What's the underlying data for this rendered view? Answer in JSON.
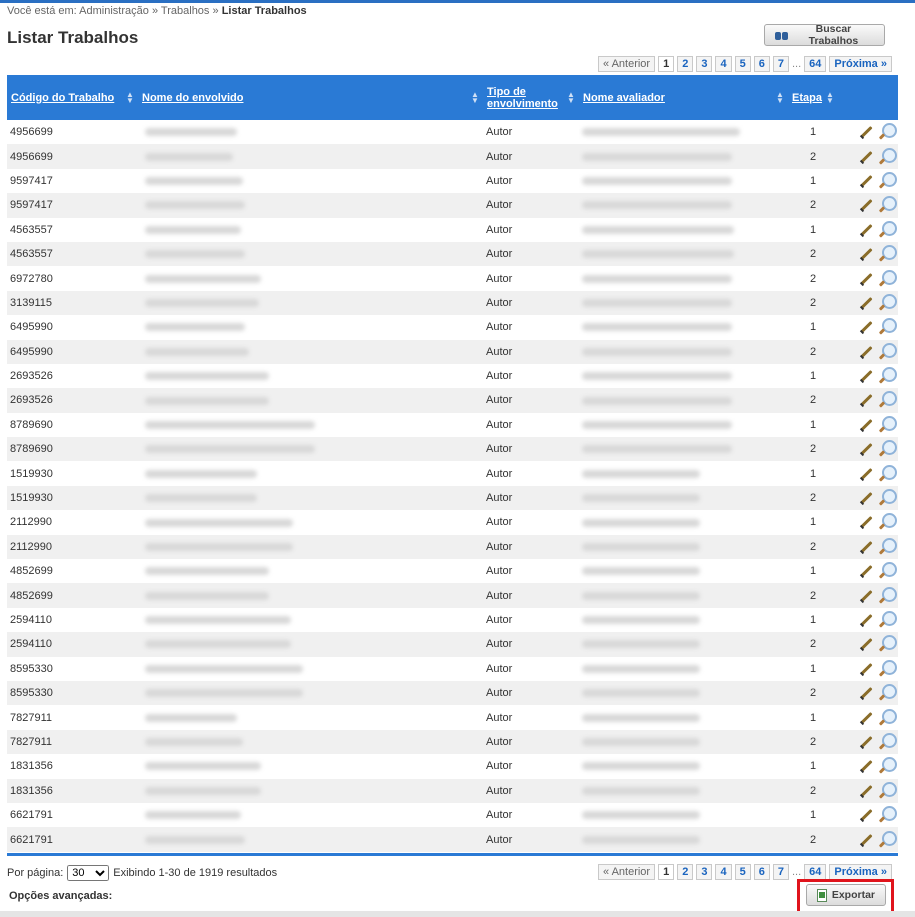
{
  "breadcrumb": {
    "prefix": "Você está em:",
    "items": [
      "Administração",
      "Trabalhos",
      "Listar Trabalhos"
    ],
    "separator": "»"
  },
  "page_title": "Listar Trabalhos",
  "search_button": "Buscar Trabalhos",
  "pagination": {
    "prev": "« Anterior",
    "pages": [
      "1",
      "2",
      "3",
      "4",
      "5",
      "6",
      "7"
    ],
    "ellipsis": "...",
    "last": "64",
    "next": "Próxima »",
    "current": "1"
  },
  "columns": {
    "codigo": "Código do Trabalho",
    "nome": "Nome do envolvido",
    "tipo_1": "Tipo de",
    "tipo_2": "envolvimento",
    "avaliador": "Nome avaliador",
    "etapa": "Etapa"
  },
  "rows": [
    {
      "codigo": "4956699",
      "tipo": "Autor",
      "etapa": "1"
    },
    {
      "codigo": "4956699",
      "tipo": "Autor",
      "etapa": "2"
    },
    {
      "codigo": "9597417",
      "tipo": "Autor",
      "etapa": "1"
    },
    {
      "codigo": "9597417",
      "tipo": "Autor",
      "etapa": "2"
    },
    {
      "codigo": "4563557",
      "tipo": "Autor",
      "etapa": "1"
    },
    {
      "codigo": "4563557",
      "tipo": "Autor",
      "etapa": "2"
    },
    {
      "codigo": "6972780",
      "tipo": "Autor",
      "etapa": "2"
    },
    {
      "codigo": "3139115",
      "tipo": "Autor",
      "etapa": "2"
    },
    {
      "codigo": "6495990",
      "tipo": "Autor",
      "etapa": "1"
    },
    {
      "codigo": "6495990",
      "tipo": "Autor",
      "etapa": "2"
    },
    {
      "codigo": "2693526",
      "tipo": "Autor",
      "etapa": "1"
    },
    {
      "codigo": "2693526",
      "tipo": "Autor",
      "etapa": "2"
    },
    {
      "codigo": "8789690",
      "tipo": "Autor",
      "etapa": "1"
    },
    {
      "codigo": "8789690",
      "tipo": "Autor",
      "etapa": "2"
    },
    {
      "codigo": "1519930",
      "tipo": "Autor",
      "etapa": "1"
    },
    {
      "codigo": "1519930",
      "tipo": "Autor",
      "etapa": "2"
    },
    {
      "codigo": "2112990",
      "tipo": "Autor",
      "etapa": "1"
    },
    {
      "codigo": "2112990",
      "tipo": "Autor",
      "etapa": "2"
    },
    {
      "codigo": "4852699",
      "tipo": "Autor",
      "etapa": "1"
    },
    {
      "codigo": "4852699",
      "tipo": "Autor",
      "etapa": "2"
    },
    {
      "codigo": "2594110",
      "tipo": "Autor",
      "etapa": "1"
    },
    {
      "codigo": "2594110",
      "tipo": "Autor",
      "etapa": "2"
    },
    {
      "codigo": "8595330",
      "tipo": "Autor",
      "etapa": "1"
    },
    {
      "codigo": "8595330",
      "tipo": "Autor",
      "etapa": "2"
    },
    {
      "codigo": "7827911",
      "tipo": "Autor",
      "etapa": "1"
    },
    {
      "codigo": "7827911",
      "tipo": "Autor",
      "etapa": "2"
    },
    {
      "codigo": "1831356",
      "tipo": "Autor",
      "etapa": "1"
    },
    {
      "codigo": "1831356",
      "tipo": "Autor",
      "etapa": "2"
    },
    {
      "codigo": "6621791",
      "tipo": "Autor",
      "etapa": "1"
    },
    {
      "codigo": "6621791",
      "tipo": "Autor",
      "etapa": "2"
    }
  ],
  "footer": {
    "per_page_label": "Por página:",
    "per_page_value": "30",
    "results_text": "Exibindo 1-30 de 1919 resultados",
    "advanced_options": "Opções avançadas:",
    "export_button": "Exportar"
  },
  "colors": {
    "header_bg": "#2a7ad5",
    "link": "#1a64bf",
    "export_highlight": "#e0141c"
  }
}
